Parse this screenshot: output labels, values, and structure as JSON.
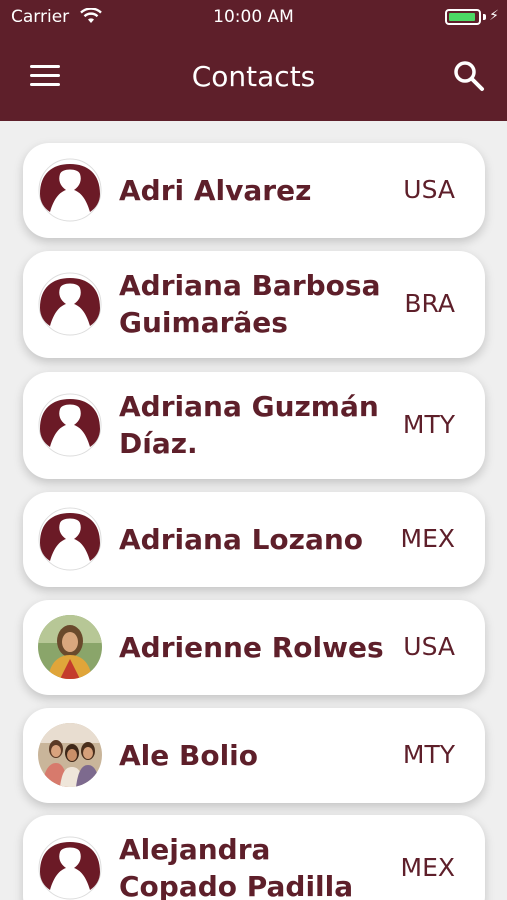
{
  "status_bar": {
    "carrier": "Carrier",
    "time": "10:00 AM"
  },
  "header": {
    "title": "Contacts"
  },
  "icons": {
    "menu": "menu-icon",
    "search": "search-icon",
    "avatar_default": "person-silhouette-icon"
  },
  "colors": {
    "brand": "#5e1f2a",
    "background": "#efefef",
    "card": "#ffffff",
    "battery": "#4cd964"
  },
  "contacts": [
    {
      "line1": "Adri Alvarez",
      "line2": "",
      "country": "USA",
      "avatar": "default"
    },
    {
      "line1": "Adriana Barbosa",
      "line2": "Guimarães",
      "country": "BRA",
      "avatar": "default"
    },
    {
      "line1": "Adriana Guzmán",
      "line2": "Díaz.",
      "country": "MTY",
      "avatar": "default"
    },
    {
      "line1": "Adriana Lozano",
      "line2": "",
      "country": "MEX",
      "avatar": "default"
    },
    {
      "line1": "Adrienne Rolwes",
      "line2": "",
      "country": "USA",
      "avatar": "photo"
    },
    {
      "line1": "Ale Bolio",
      "line2": "",
      "country": "MTY",
      "avatar": "photo"
    },
    {
      "line1": "Alejandra",
      "line2": "Copado Padilla",
      "country": "MEX",
      "avatar": "default"
    }
  ]
}
